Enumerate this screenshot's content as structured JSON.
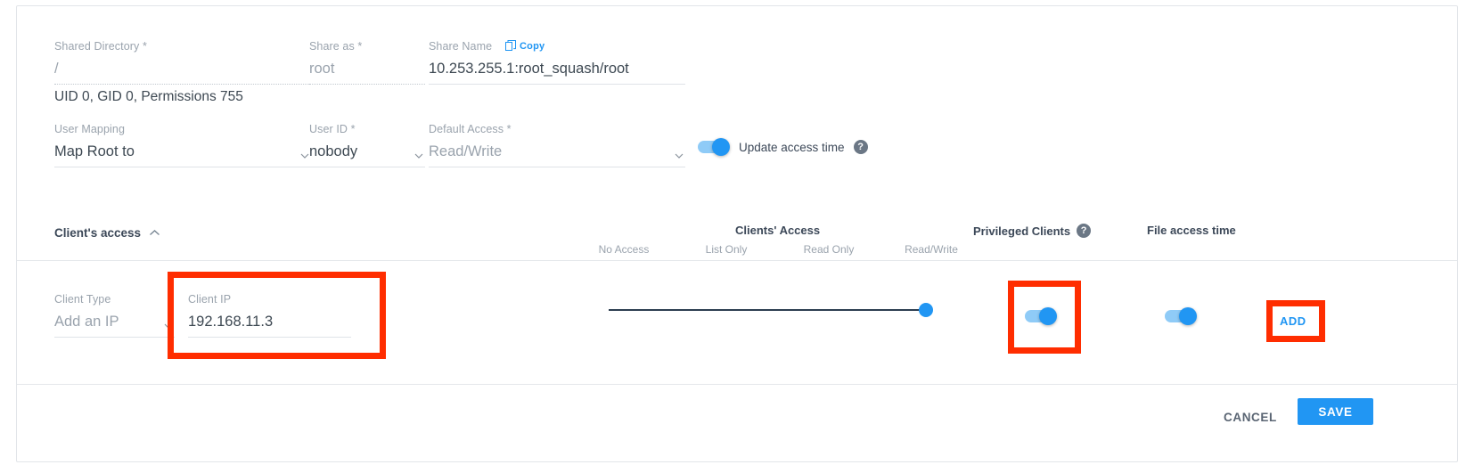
{
  "form": {
    "shared_directory": {
      "label": "Shared Directory *",
      "value": "/"
    },
    "share_as": {
      "label": "Share as *",
      "value": "root"
    },
    "share_name": {
      "label": "Share Name",
      "value": "10.253.255.1:root_squash/root",
      "copy_label": "Copy",
      "copy_icon": "copy-icon"
    },
    "permissions_summary": "UID 0, GID 0, Permissions 755",
    "user_mapping": {
      "label": "User Mapping",
      "value": "Map Root to",
      "caret_icon": "chevron-down-icon"
    },
    "user_id": {
      "label": "User ID *",
      "value": "nobody",
      "caret_icon": "chevron-down-icon"
    },
    "default_access": {
      "label": "Default Access *",
      "value": "Read/Write",
      "caret_icon": "chevron-down-icon"
    },
    "update_access_time": {
      "label": "Update access time",
      "state": "on",
      "help_icon": "help-icon",
      "help_glyph": "?"
    }
  },
  "clients_access_section": {
    "title": "Client's access",
    "collapse_icon": "chevron-up-icon",
    "columns": {
      "clients_access": "Clients' Access",
      "privileged_clients": "Privileged Clients",
      "privileged_help_icon": "help-icon",
      "privileged_help_glyph": "?",
      "file_access_time": "File access time"
    },
    "slider_ticks": [
      "No Access",
      "List Only",
      "Read Only",
      "Read/Write"
    ],
    "row": {
      "client_type": {
        "label": "Client Type",
        "value": "Add an IP",
        "caret_icon": "chevron-down-icon"
      },
      "client_ip": {
        "label": "Client IP",
        "value": "192.168.11.3"
      },
      "access_slider": {
        "value": "Read/Write",
        "position_index": 3,
        "min_index": 0,
        "max_index": 3
      },
      "privileged_clients_toggle": "on",
      "file_access_time_toggle": "on",
      "add_label": "ADD"
    }
  },
  "footer": {
    "cancel_label": "CANCEL",
    "save_label": "SAVE"
  },
  "colors": {
    "accent": "#2196f3",
    "highlight": "#ff2d00",
    "label": "#9aa3ad",
    "text": "#3d4852",
    "heading": "#3c4858",
    "track": "#2c3e50"
  }
}
